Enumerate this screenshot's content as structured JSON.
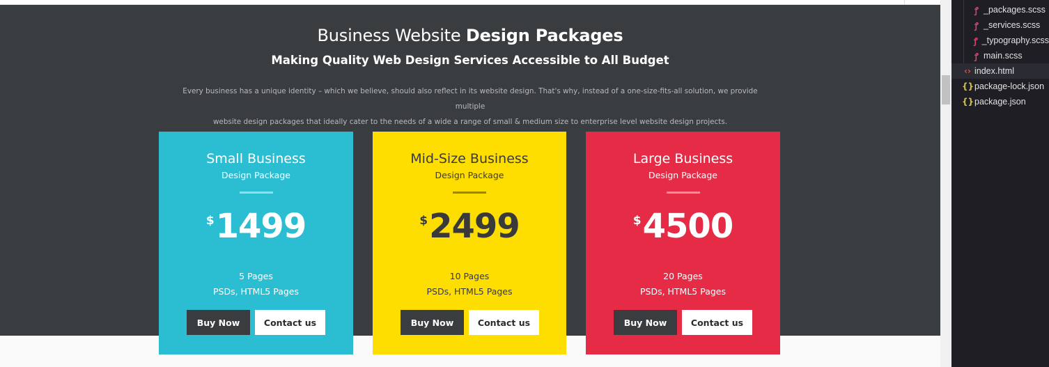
{
  "page": {
    "heading_prefix": "Business Website ",
    "heading_bold": "Design Packages",
    "subheading": "Making Quality Web Design Services Accessible to All Budget",
    "intro_line1": "Every business has a unique identity – which we believe, should also reflect in its website design. That's why, instead of a one-size-fits-all solution, we provide multiple",
    "intro_line2": "website design packages that ideally cater to the needs of a wide a range of small & medium size to enterprise level website design projects."
  },
  "packages": [
    {
      "title": "Small Business",
      "subtitle": "Design Package",
      "currency": "$",
      "price": "1499",
      "pages": "5 Pages",
      "formats": "PSDs, HTML5 Pages",
      "buy_label": "Buy Now",
      "contact_label": "Contact us",
      "color": "#2bbed3"
    },
    {
      "title": "Mid-Size Business",
      "subtitle": "Design Package",
      "currency": "$",
      "price": "2499",
      "pages": "10 Pages",
      "formats": "PSDs, HTML5 Pages",
      "buy_label": "Buy Now",
      "contact_label": "Contact us",
      "color": "#fede00"
    },
    {
      "title": "Large Business",
      "subtitle": "Design Package",
      "currency": "$",
      "price": "4500",
      "pages": "20 Pages",
      "formats": "PSDs, HTML5 Pages",
      "buy_label": "Buy Now",
      "contact_label": "Contact us",
      "color": "#e62b46"
    }
  ],
  "explorer": {
    "files": [
      {
        "name": "_packages.scss",
        "icon": "sass-icon"
      },
      {
        "name": "_services.scss",
        "icon": "sass-icon"
      },
      {
        "name": "_typography.scss",
        "icon": "sass-icon"
      },
      {
        "name": "main.scss",
        "icon": "sass-icon"
      },
      {
        "name": "index.html",
        "icon": "html-icon"
      },
      {
        "name": "package-lock.json",
        "icon": "json-icon"
      },
      {
        "name": "package.json",
        "icon": "json-icon"
      }
    ]
  },
  "colors": {
    "hero_background": "#3a3d40",
    "explorer_background": "#1e1e24"
  }
}
